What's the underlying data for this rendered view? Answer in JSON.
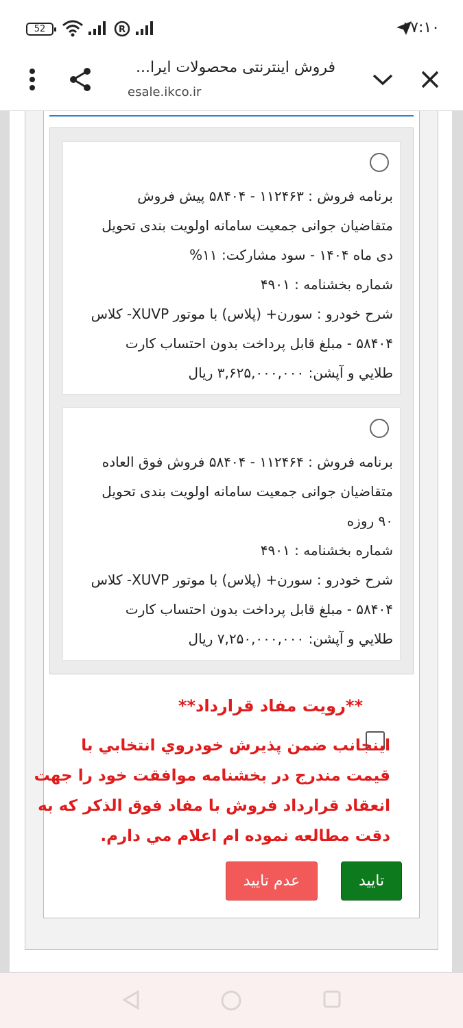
{
  "status_bar": {
    "battery": "52",
    "time": "۱۷:۱۰"
  },
  "browser": {
    "title": "فروش اینترنتی محصولات ایرا...",
    "url": "esale.ikco.ir"
  },
  "options": [
    {
      "lines": [
        "برنامه فروش : ۱۱۲۴۶۳ - ۵۸۴۰۴ پیش فروش",
        "متقاضیان جوانی جمعیت سامانه اولویت بندی تحویل",
        "دی ماه ۱۴۰۴ - سود مشارکت: ۱۱%",
        "شماره بخشنامه : ۴۹۰۱",
        "شرح خودرو : سورن+ (پلاس) با موتور XUVP- کلاس",
        "۵۸۴۰۴ - مبلغ قابل پرداخت بدون احتساب کارت",
        "طلايي و آپشن: ۳,۶۲۵,۰۰۰,۰۰۰ ریال"
      ]
    },
    {
      "lines": [
        "برنامه فروش : ۱۱۲۴۶۴ - ۵۸۴۰۴ فروش فوق العاده",
        "متقاضیان جوانی جمعیت سامانه اولویت بندی تحویل",
        "۹۰ روزه",
        "شماره بخشنامه : ۴۹۰۱",
        "شرح خودرو : سورن+ (پلاس) با موتور XUVP- کلاس",
        "۵۸۴۰۴ - مبلغ قابل پرداخت بدون احتساب کارت",
        "طلايي و آپشن: ۷,۲۵۰,۰۰۰,۰۰۰ ریال"
      ]
    }
  ],
  "contract": {
    "title": "**رویت مفاد قرارداد**",
    "agreement_lines": [
      "اینجانب ضمن پذیرش خودروي انتخابي با",
      "قیمت مندرج در بخشنامه موافقت خود را جهت",
      "انعقاد قرارداد فروش با مفاد فوق الذکر که به",
      "دقت مطالعه نموده ام اعلام مي دارم."
    ]
  },
  "buttons": {
    "confirm": "تایید",
    "reject": "عدم تایید"
  },
  "colors": {
    "warning_text": "#e01b1b",
    "confirm_button": "#0d7a1d",
    "reject_button": "#f25a5a",
    "accent_line": "#2f7fd0"
  },
  "icons": {
    "nav": "telegram-send-icon",
    "browser": [
      "close-icon",
      "chevron-down-icon",
      "share-icon",
      "more-vert-icon"
    ]
  }
}
